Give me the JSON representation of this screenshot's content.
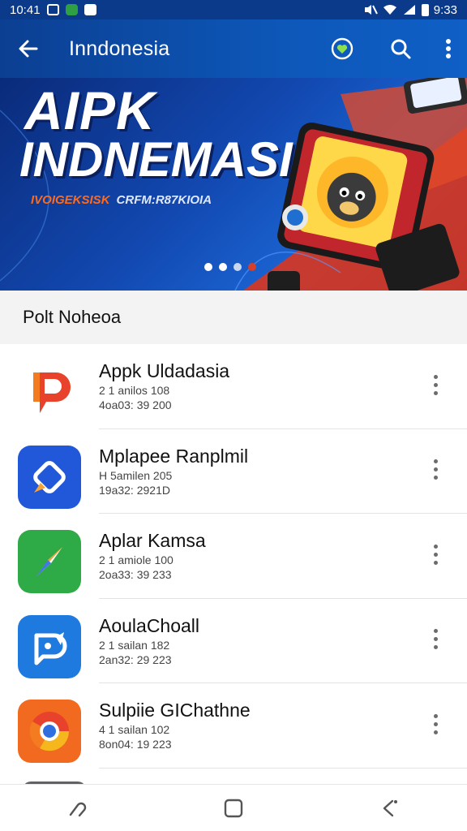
{
  "status_bar": {
    "time": "10:41",
    "clock_right": "9:33",
    "icons": [
      "gallery-icon",
      "whatsapp-icon",
      "message-icon",
      "mute-icon",
      "wifi-icon",
      "signal-icon",
      "battery-icon"
    ]
  },
  "app_bar": {
    "title": "Inndonesia",
    "back_icon": "arrow-left-icon",
    "actions": [
      "heart-icon",
      "search-icon",
      "more-vert-icon"
    ],
    "color": "#0d57b8"
  },
  "banner": {
    "title_line1": "AIPK",
    "title_line2": "INDNEMASI",
    "subtitle_orange": "IVOIGEKSISK",
    "subtitle_white": "CRFM:R87KIOIA",
    "pager": {
      "count": 4,
      "active_index": 0
    }
  },
  "section": {
    "header": "Polt Noheoa"
  },
  "apps": [
    {
      "name": "Appk Uldadasia",
      "line1": "2 1 anilos 108",
      "line2": "4oa03: 39 200",
      "icon": "pinterest-p-icon",
      "icon_bg": "#ffffff",
      "icon_fg": "#e8452c"
    },
    {
      "name": "Mplapee Ranplmil",
      "line1": "H 5amilen 205",
      "line2": "19a32: 2921D",
      "icon": "diamond-pencil-icon",
      "icon_bg": "#2157d9",
      "icon_fg": "#ffffff"
    },
    {
      "name": "Aplar Kamsa",
      "line1": "2 1 amiole 100",
      "line2": "2oa33: 39 233",
      "icon": "compass-icon",
      "icon_bg": "#2eaa47",
      "icon_fg": "#ffffff"
    },
    {
      "name": "AoulaChoall",
      "line1": "2 1 sailan 182",
      "line2": "2an32: 29 223",
      "icon": "chat-bubble-icon",
      "icon_bg": "#1f7ae0",
      "icon_fg": "#ffffff"
    },
    {
      "name": "Sulpiie GIChathne",
      "line1": "4 1 sailan 102",
      "line2": "8on04: 19 223",
      "icon": "chrome-icon",
      "icon_bg": "#f26a1f",
      "icon_fg": "#ffffff"
    }
  ],
  "nav_bar": {
    "buttons": [
      "recents-icon",
      "home-icon",
      "back-icon"
    ]
  }
}
